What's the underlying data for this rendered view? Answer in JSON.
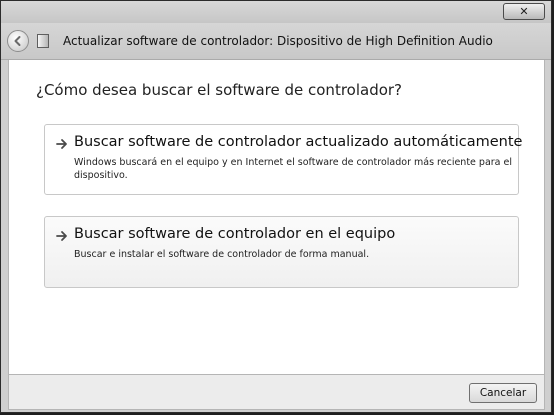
{
  "window": {
    "close_label": "✕"
  },
  "header": {
    "title": "Actualizar software de controlador: Dispositivo de High Definition Audio",
    "back_icon": "back-arrow-icon",
    "device_icon": "device-icon"
  },
  "main": {
    "question": "¿Cómo desea buscar el software de controlador?",
    "options": [
      {
        "title": "Buscar software de controlador actualizado automáticamente",
        "description": "Windows buscará en el equipo y en Internet el software de controlador más reciente para el dispositivo.",
        "icon": "arrow-right-icon"
      },
      {
        "title": "Buscar software de controlador en el equipo",
        "description": "Buscar e instalar el software de controlador de forma manual.",
        "icon": "arrow-right-icon"
      }
    ]
  },
  "footer": {
    "cancel_label": "Cancelar"
  }
}
